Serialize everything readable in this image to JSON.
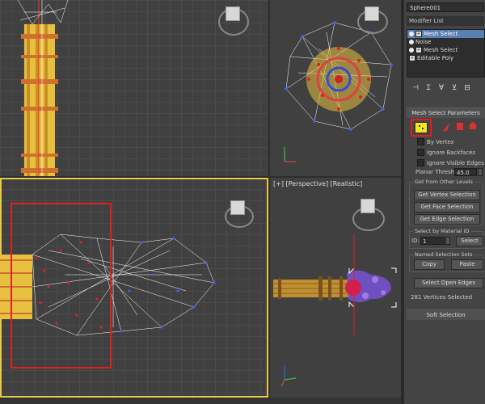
{
  "viewports": {
    "perspective_label": "[+] [Perspective] [Realistic]"
  },
  "panel": {
    "object_name": "Sphere001",
    "modifier_list_label": "Modifier List",
    "stack": [
      {
        "label": "Mesh Select",
        "selected": true
      },
      {
        "label": "Noise",
        "selected": false
      },
      {
        "label": "Mesh Select",
        "selected": false
      },
      {
        "label": "Editable Poly",
        "selected": false
      }
    ],
    "mesh_select": {
      "title": "Mesh Select Parameters",
      "by_vertex": "By Vertex",
      "ignore_backfaces": "Ignore Backfaces",
      "ignore_visible_edges": "Ignore Visible Edges",
      "planar_thresh_label": "Planar Thresh:",
      "planar_thresh_value": "45.0"
    },
    "get_from_other": {
      "title": "Get from Other Levels",
      "vertex_btn": "Get Vertex Selection",
      "face_btn": "Get Face Selection",
      "edge_btn": "Get Edge Selection"
    },
    "material_id": {
      "title": "Select by Material ID",
      "id_label": "ID:",
      "id_value": "1",
      "select_btn": "Select"
    },
    "named_sets": {
      "title": "Named Selection Sets",
      "copy_btn": "Copy",
      "paste_btn": "Paste"
    },
    "select_open_edges": "Select Open Edges",
    "status": "281 Vertices Selected",
    "soft_selection": "Soft Selection"
  },
  "colors": {
    "accent_red": "#e02020",
    "active_viewport": "#e8c948",
    "stack_selected": "#5a7fb2",
    "vertex_sub_object": "#f5e51a"
  }
}
